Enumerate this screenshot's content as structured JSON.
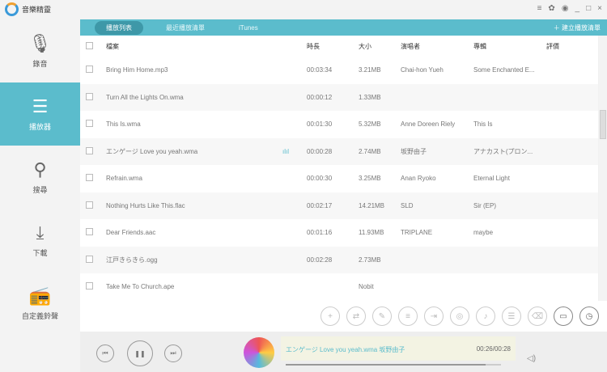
{
  "app": {
    "title": "音樂精靈"
  },
  "window": {
    "menu_icon": "≡",
    "settings_icon": "✿",
    "skin_icon": "◉",
    "minimize": "_",
    "maximize": "□",
    "close": "×"
  },
  "sidebar": {
    "items": [
      {
        "label": "錄音",
        "icon": "🎙"
      },
      {
        "label": "播放器",
        "icon": "☰"
      },
      {
        "label": "搜尋",
        "icon": "⚲"
      },
      {
        "label": "下載",
        "icon": "⤓"
      },
      {
        "label": "自定義鈴聲",
        "icon": "📻"
      }
    ]
  },
  "tabs": [
    {
      "label": "播放列表"
    },
    {
      "label": "最近播放清單"
    },
    {
      "label": "iTunes"
    }
  ],
  "new_playlist": "＋ 建立播放清單",
  "table": {
    "headers": [
      "檔案",
      "時長",
      "大小",
      "演唱者",
      "專輯",
      "評價"
    ],
    "rows": [
      {
        "file": "Bring Him Home.mp3",
        "duration": "00:03:34",
        "size": "3.21MB",
        "artist": "Chai-hon Yueh",
        "album": "Some Enchanted E..."
      },
      {
        "file": "Turn All the Lights On.wma",
        "duration": "00:00:12",
        "size": "1.33MB",
        "artist": "",
        "album": ""
      },
      {
        "file": "This Is.wma",
        "duration": "00:01:30",
        "size": "5.32MB",
        "artist": "Anne Doreen Riely",
        "album": "This Is"
      },
      {
        "file": "エンゲージ Love you yeah.wma",
        "duration": "00:00:28",
        "size": "2.74MB",
        "artist": "坂野由子",
        "album": "アナカスト(プロン...",
        "playing": "ılıl"
      },
      {
        "file": "Refrain.wma",
        "duration": "00:00:30",
        "size": "3.25MB",
        "artist": "Anan Ryoko",
        "album": "Eternal Light"
      },
      {
        "file": "Nothing Hurts Like This.flac",
        "duration": "00:02:17",
        "size": "14.21MB",
        "artist": "SLD",
        "album": "Sir (EP)"
      },
      {
        "file": "Dear Friends.aac",
        "duration": "00:01:16",
        "size": "11.93MB",
        "artist": "TRIPLANE",
        "album": "maybe"
      },
      {
        "file": "江戸きらきら.ogg",
        "duration": "00:02:28",
        "size": "2.73MB",
        "artist": "",
        "album": ""
      },
      {
        "file": "Take Me To Church.ape",
        "duration": "",
        "size": "Nobit",
        "artist": "",
        "album": ""
      }
    ]
  },
  "toolbar": [
    {
      "icon": "add"
    },
    {
      "icon": "convert"
    },
    {
      "icon": "edit"
    },
    {
      "icon": "list"
    },
    {
      "icon": "export"
    },
    {
      "icon": "cd"
    },
    {
      "icon": "ringtone"
    },
    {
      "icon": "playlist"
    },
    {
      "icon": "delete"
    },
    {
      "icon": "folder"
    },
    {
      "icon": "history"
    }
  ],
  "player": {
    "now_playing": "エンゲージ Love you yeah.wma  坂野由子",
    "time": "00:26/00:28",
    "progress": 0.93
  }
}
